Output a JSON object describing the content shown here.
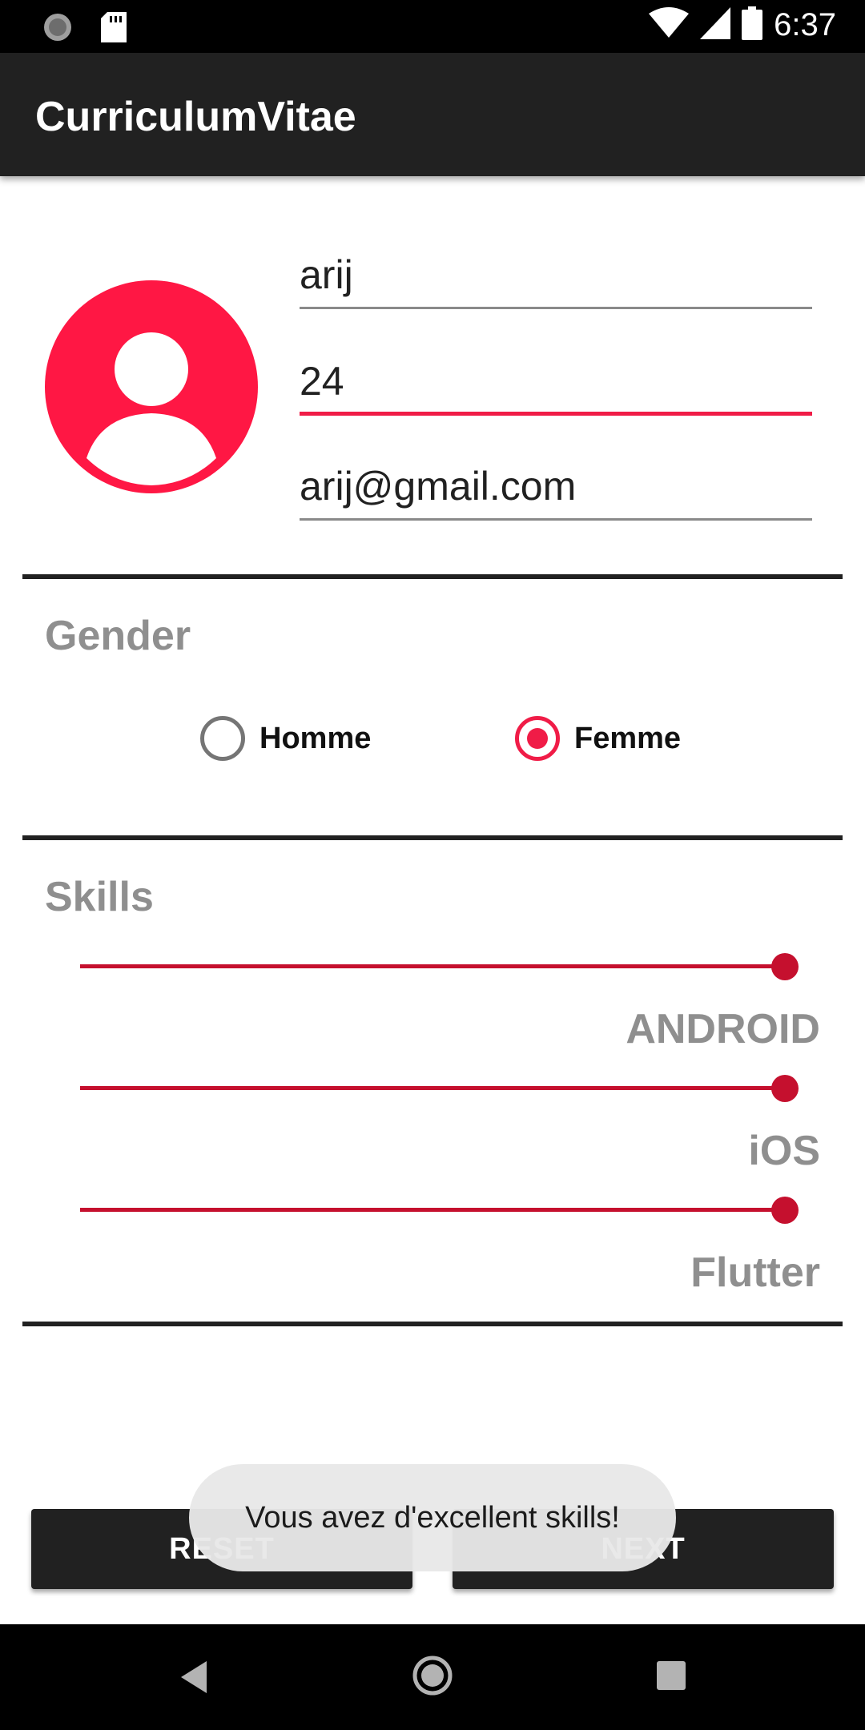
{
  "status_bar": {
    "time": "6:37"
  },
  "app_bar": {
    "title": "CurriculumVitae"
  },
  "profile": {
    "name": "arij",
    "age": "24",
    "email": "arij@gmail.com"
  },
  "gender": {
    "title": "Gender",
    "options": [
      {
        "label": "Homme",
        "checked": false
      },
      {
        "label": "Femme",
        "checked": true
      }
    ]
  },
  "skills": {
    "title": "Skills",
    "items": [
      {
        "label": "ANDROID",
        "level": 1.0
      },
      {
        "label": "iOS",
        "level": 1.0
      },
      {
        "label": "Flutter",
        "level": 1.0
      }
    ]
  },
  "buttons": {
    "reset": "RESET",
    "next": "NEXT"
  },
  "toast": {
    "message": "Vous avez d'excellent skills!"
  },
  "colors": {
    "accent": "#f01c47",
    "slider": "#c5102e",
    "app_bar": "#212121",
    "section_label": "#8f8f8f"
  }
}
